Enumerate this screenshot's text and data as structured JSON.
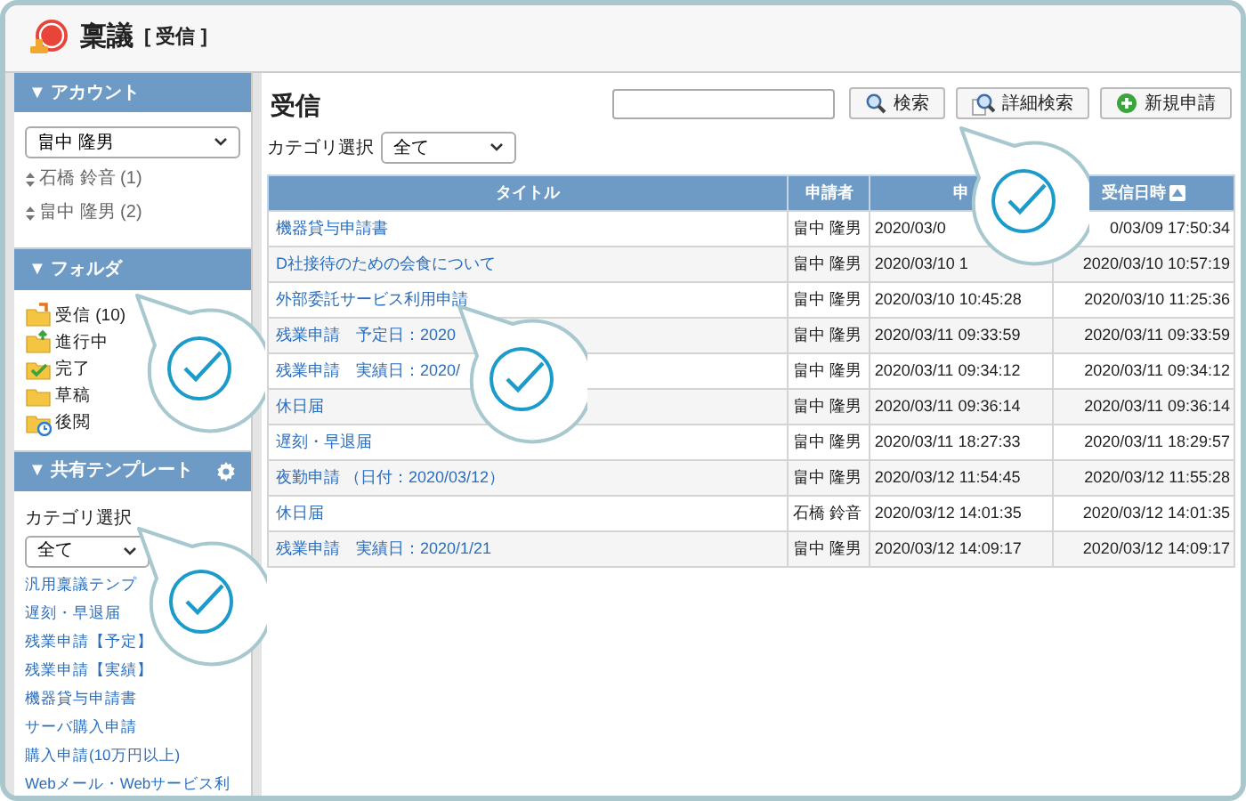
{
  "header": {
    "app_title": "稟議",
    "subtitle": "[ 受信 ]"
  },
  "sidebar": {
    "account": {
      "title": "▼ アカウント",
      "select_value": "畠中 隆男",
      "items": [
        {
          "label": "石橋 鈴音 (1)"
        },
        {
          "label": "畠中 隆男 (2)"
        }
      ]
    },
    "folders": {
      "title": "▼ フォルダ",
      "items": [
        {
          "label": "受信 (10)",
          "kind": "inbox"
        },
        {
          "label": "進行中",
          "kind": "progress"
        },
        {
          "label": "完了",
          "kind": "done"
        },
        {
          "label": "草稿",
          "kind": "draft"
        },
        {
          "label": "後閲",
          "kind": "later"
        }
      ]
    },
    "templates": {
      "title": "▼ 共有テンプレート",
      "category_label": "カテゴリ選択",
      "select_value": "全て",
      "items": [
        "汎用稟議テンプ",
        "遅刻・早退届",
        "残業申請【予定】",
        "残業申請【実績】",
        "機器貸与申請書",
        "サーバ購入申請",
        "購入申請(10万円以上)",
        "Webメール・Webサービス利"
      ]
    }
  },
  "main": {
    "title": "受信",
    "category_label": "カテゴリ選択",
    "category_value": "全て",
    "buttons": [
      {
        "label": "検索",
        "kind": "search"
      },
      {
        "label": "詳細検索",
        "kind": "advanced"
      },
      {
        "label": "新規申請",
        "kind": "new"
      }
    ],
    "table": {
      "columns": [
        {
          "label": "タイトル",
          "sorted": false
        },
        {
          "label": "申請者",
          "sorted": false
        },
        {
          "label": "申",
          "sorted": false
        },
        {
          "label": "受信日時",
          "sorted": true
        }
      ],
      "rows": [
        {
          "title": "機器貸与申請書",
          "applicant": "畠中 隆男",
          "column_3": "2020/03/0",
          "received": "0/03/09 17:50:34"
        },
        {
          "title": "D社接待のための会食について",
          "applicant": "畠中 隆男",
          "column_3": "2020/03/10 1",
          "received": "2020/03/10 10:57:19"
        },
        {
          "title": "外部委託サービス利用申請",
          "applicant": "畠中 隆男",
          "column_3": "2020/03/10 10:45:28",
          "received": "2020/03/10 11:25:36"
        },
        {
          "title": "残業申請　予定日：2020",
          "applicant": "畠中 隆男",
          "column_3": "2020/03/11 09:33:59",
          "received": "2020/03/11 09:33:59"
        },
        {
          "title": "残業申請　実績日：2020/",
          "applicant": "畠中 隆男",
          "column_3": "2020/03/11 09:34:12",
          "received": "2020/03/11 09:34:12"
        },
        {
          "title": "休日届",
          "applicant": "畠中 隆男",
          "column_3": "2020/03/11 09:36:14",
          "received": "2020/03/11 09:36:14"
        },
        {
          "title": "遅刻・早退届",
          "applicant": "畠中 隆男",
          "column_3": "2020/03/11 18:27:33",
          "received": "2020/03/11 18:29:57"
        },
        {
          "title": "夜勤申請 （日付：2020/03/12）",
          "applicant": "畠中 隆男",
          "column_3": "2020/03/12 11:54:45",
          "received": "2020/03/12 11:55:28"
        },
        {
          "title": "休日届",
          "applicant": "石橋 鈴音",
          "column_3": "2020/03/12 14:01:35",
          "received": "2020/03/12 14:01:35"
        },
        {
          "title": "残業申請　実績日：2020/1/21",
          "applicant": "畠中 隆男",
          "column_3": "2020/03/12 14:09:17",
          "received": "2020/03/12 14:09:17"
        }
      ]
    }
  }
}
